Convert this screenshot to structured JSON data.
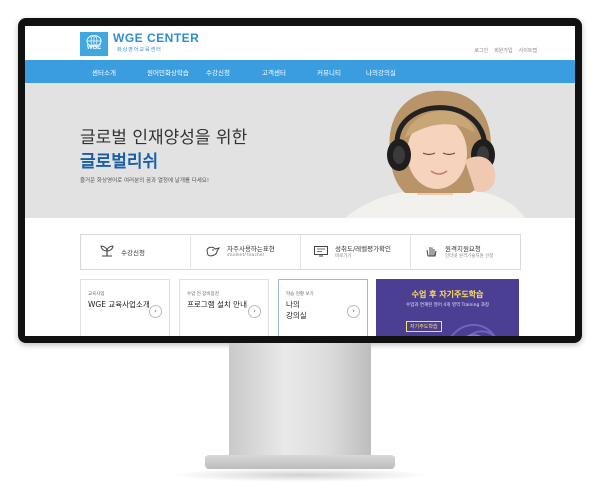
{
  "header": {
    "logo_mark": "WGE",
    "logo_title": "WGE CENTER",
    "logo_subtitle": "화상영어교육센터",
    "util_links": [
      "로그인",
      "회원가입",
      "사이트맵"
    ]
  },
  "nav": {
    "items": [
      "센터소개",
      "원어민화상학습",
      "수강신청",
      "고객센터",
      "커뮤니티",
      "나의강의실"
    ]
  },
  "hero": {
    "title": "글로벌 인재양성을 위한",
    "brand": "글로벌리쉬",
    "description": "즐거운 화상영어로 여러분의 꿈과 열정에 날개를 다세요!"
  },
  "quick_menu": [
    {
      "label": "수강신청",
      "sub": "",
      "icon": "plant-icon"
    },
    {
      "label": "자주사용하는표현",
      "sub": "student/ teacher",
      "icon": "bird-icon"
    },
    {
      "label": "성취도/레벨평가확인",
      "sub": "바로가기",
      "icon": "monitor-icon"
    },
    {
      "label": "원격지원요청",
      "sub": "인터넷 원격기술지원 신청",
      "icon": "hand-icon"
    }
  ],
  "cards": [
    {
      "small": "교육사업",
      "title": "WGE 교육사업소개"
    },
    {
      "small": "수업 전 장비점검",
      "title": "프로그램 설치 안내"
    },
    {
      "small": "학습 현황 보기",
      "title": "나의\n강의실"
    }
  ],
  "promo": {
    "title": "수업 후 자기주도학습",
    "subtitle": "수업과 연계된 영어 4개 영역 Training 과정",
    "badge": "자기주도학습"
  },
  "colors": {
    "nav_bg": "#3a9de0",
    "brand_blue": "#1b5ea8",
    "promo_bg": "#4a3f92",
    "promo_accent": "#ffe15a"
  }
}
